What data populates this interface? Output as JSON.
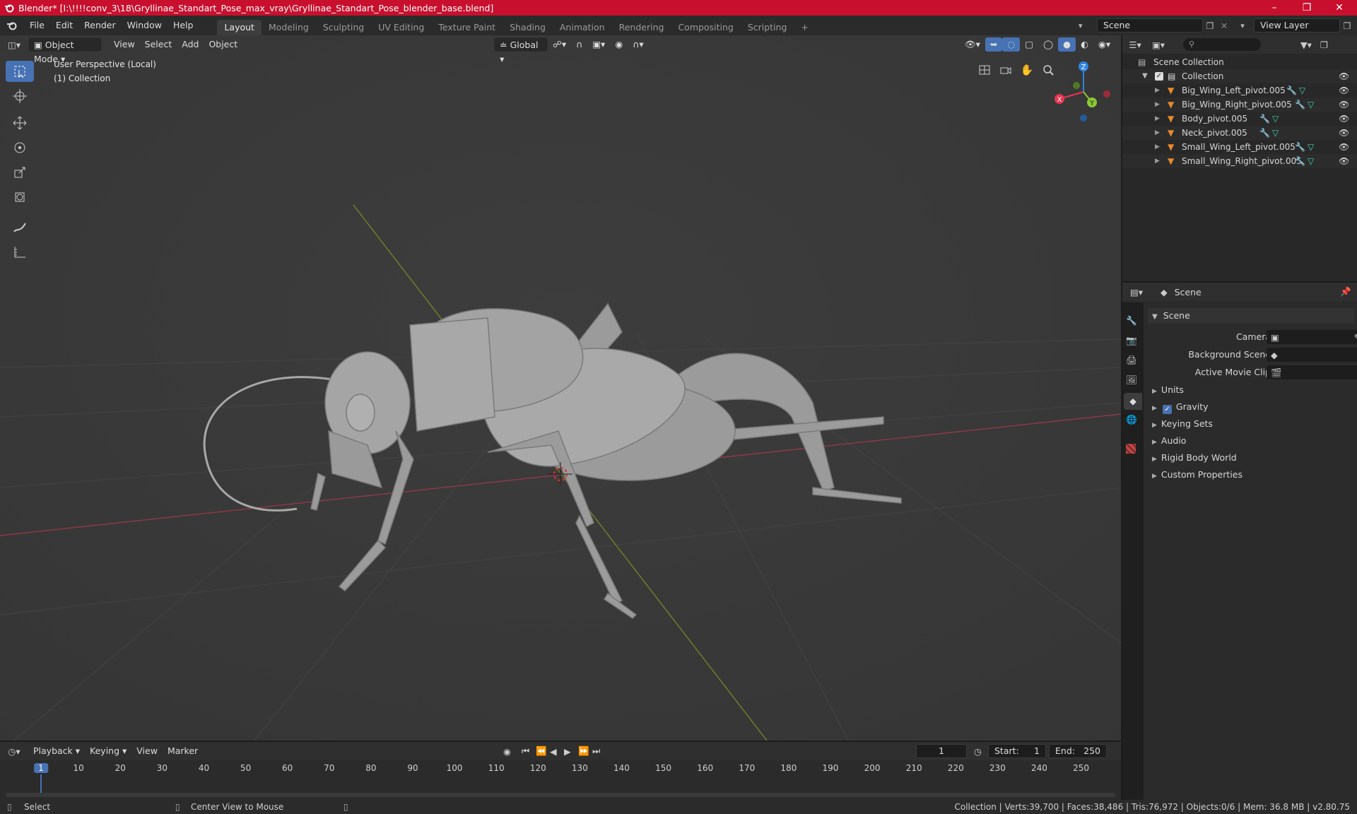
{
  "window": {
    "title": "Blender* [I:\\!!!!conv_3\\18\\Gryllinae_Standart_Pose_max_vray\\Gryllinae_Standart_Pose_blender_base.blend]"
  },
  "menu": {
    "items": [
      "File",
      "Edit",
      "Render",
      "Window",
      "Help"
    ]
  },
  "workspaces": {
    "tabs": [
      "Layout",
      "Modeling",
      "Sculpting",
      "UV Editing",
      "Texture Paint",
      "Shading",
      "Animation",
      "Rendering",
      "Compositing",
      "Scripting"
    ],
    "add": "+"
  },
  "scene_field": "Scene",
  "view_layer_field": "View Layer",
  "viewport": {
    "mode": "Object Mode",
    "menus": [
      "View",
      "Select",
      "Add",
      "Object"
    ],
    "orientation": "Global",
    "overlay_line1": "User Perspective (Local)",
    "overlay_line2": "(1) Collection",
    "gizmo": {
      "x": "X",
      "y": "Y",
      "z": "Z"
    }
  },
  "outliner": {
    "root": "Scene Collection",
    "collection": "Collection",
    "objects": [
      "Big_Wing_Left_pivot.005",
      "Big_Wing_Right_pivot.005",
      "Body_pivot.005",
      "Neck_pivot.005",
      "Small_Wing_Left_pivot.005",
      "Small_Wing_Right_pivot.005"
    ]
  },
  "properties": {
    "context": "Scene",
    "panel": "Scene",
    "camera_label": "Camera",
    "background_label": "Background Scene",
    "clip_label": "Active Movie Clip",
    "sections": [
      "Units",
      "Gravity",
      "Keying Sets",
      "Audio",
      "Rigid Body World",
      "Custom Properties"
    ],
    "gravity_checked": true
  },
  "timeline": {
    "menus": [
      "Playback",
      "Keying",
      "View",
      "Marker"
    ],
    "current_frame": "1",
    "start_label": "Start:",
    "start": "1",
    "end_label": "End:",
    "end": "250",
    "ticks": [
      "1",
      "10",
      "20",
      "30",
      "40",
      "50",
      "60",
      "70",
      "80",
      "90",
      "100",
      "110",
      "120",
      "130",
      "140",
      "150",
      "160",
      "170",
      "180",
      "190",
      "200",
      "210",
      "220",
      "230",
      "240",
      "250"
    ]
  },
  "status": {
    "select": "Select",
    "center": "Center View to Mouse",
    "stats": "Collection | Verts:39,700 | Faces:38,486 | Tris:76,972 | Objects:0/6 | Mem: 36.8 MB | v2.80.75"
  },
  "colors": {
    "title_bar": "#c8102e",
    "accent": "#4772b3",
    "x_axis": "#e8364f",
    "y_axis": "#8bc833",
    "z_axis": "#2f84e3",
    "object_icon": "#e88a2c",
    "modifier_icon": "#6b9be8",
    "mesh_icon": "#3fd5b5"
  }
}
